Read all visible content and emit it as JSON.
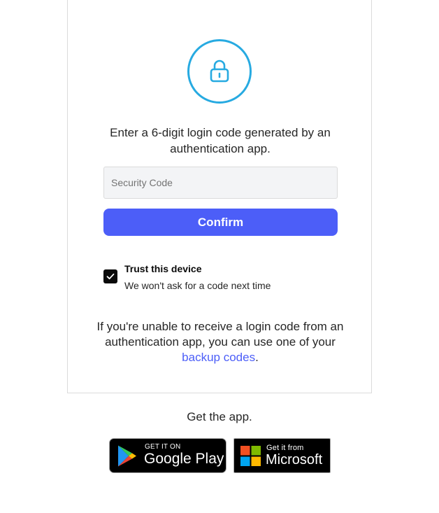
{
  "instructions": "Enter a 6-digit login code generated by an authentication app.",
  "security_code": {
    "placeholder": "Security Code",
    "value": ""
  },
  "confirm_label": "Confirm",
  "trust_device": {
    "checked": true,
    "title": "Trust this device",
    "subtitle": "We won't ask for a code next time"
  },
  "backup": {
    "text_before": "If you're unable to receive a login code from an authentication app, you can use one of your",
    "link_label": "backup codes",
    "text_after": "."
  },
  "get_app": "Get the app.",
  "badges": {
    "google_play": {
      "small": "GET IT ON",
      "big": "Google Play"
    },
    "microsoft": {
      "small": "Get it from",
      "big": "Microsoft"
    }
  },
  "colors": {
    "accent": "#4c5ef8",
    "lock_icon": "#27aae1",
    "checkbox": "#0a0a0a"
  },
  "icons": {
    "lock": "lock-icon",
    "check": "check-icon",
    "google_play": "google-play-icon",
    "microsoft": "microsoft-icon"
  }
}
